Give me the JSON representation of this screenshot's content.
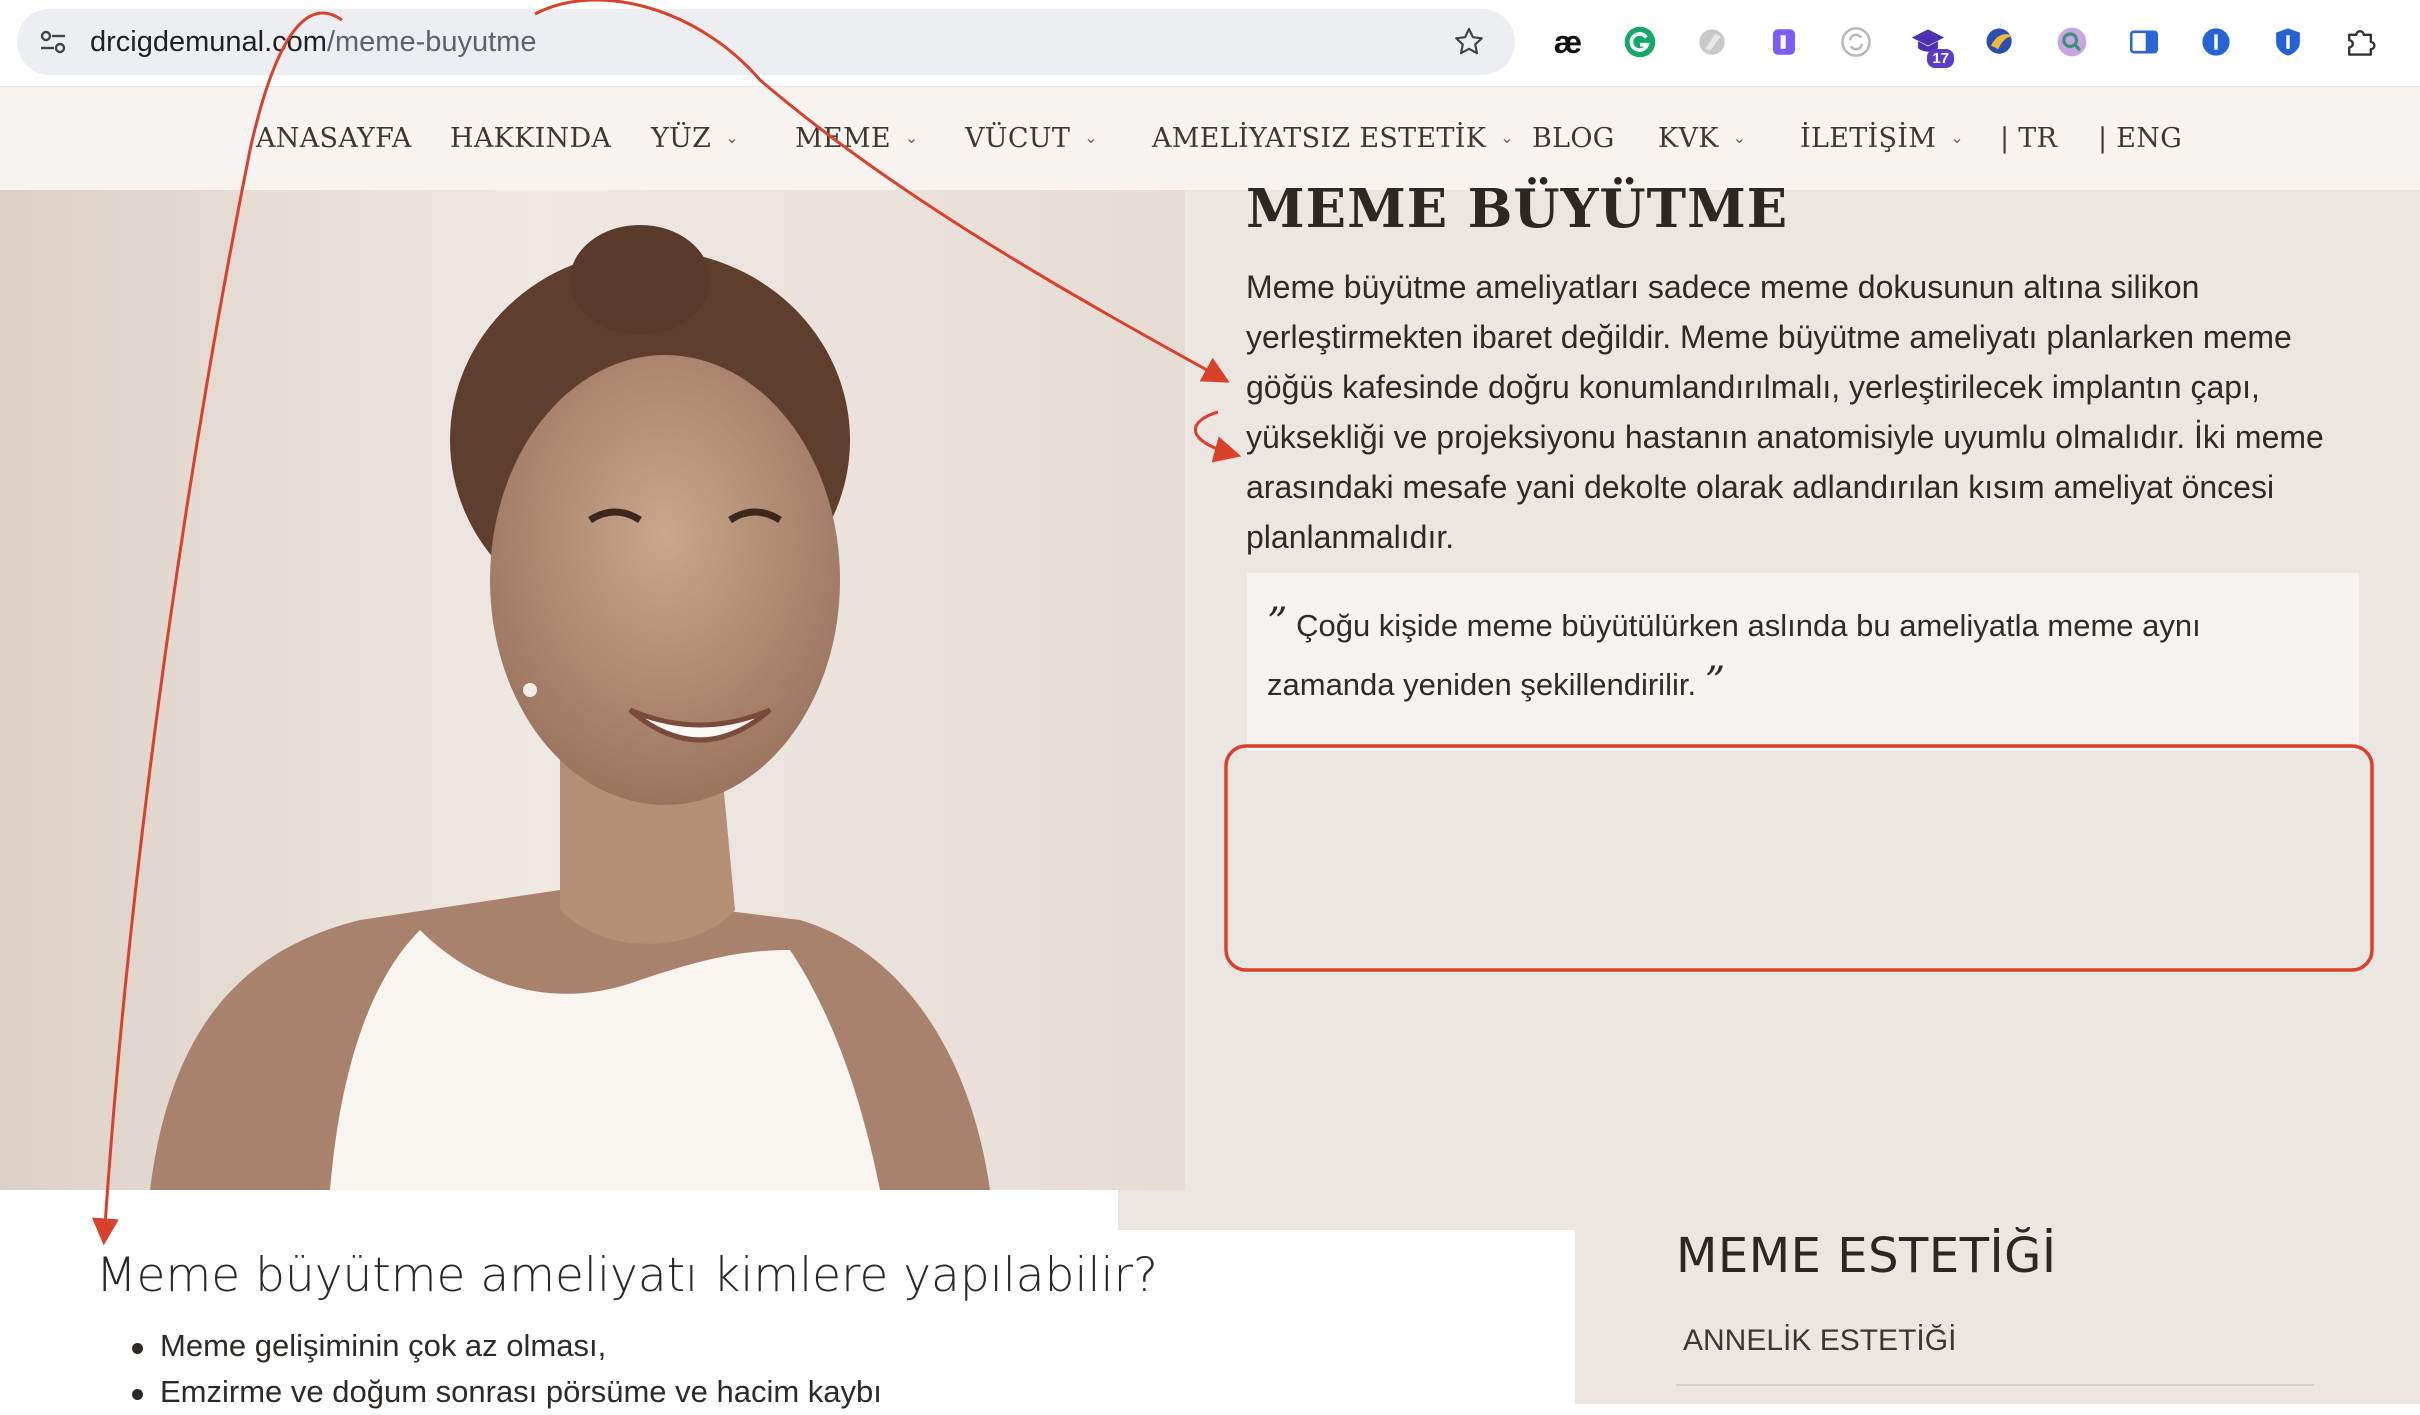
{
  "browser": {
    "url_domain": "drcigdemunal.com",
    "url_path": "/meme-buyutme",
    "extensions": {
      "ae_label": "æ",
      "badge_count": "17"
    }
  },
  "nav": {
    "items": [
      {
        "label": "ANASAYFA",
        "has_dropdown": false
      },
      {
        "label": "HAKKINDA",
        "has_dropdown": false
      },
      {
        "label": "YÜZ",
        "has_dropdown": true
      },
      {
        "label": "MEME",
        "has_dropdown": true
      },
      {
        "label": "VÜCUT",
        "has_dropdown": true
      },
      {
        "label": "AMELİYATSIZ ESTETİK",
        "has_dropdown": true
      },
      {
        "label": "BLOG",
        "has_dropdown": false
      },
      {
        "label": "KVK",
        "has_dropdown": true
      },
      {
        "label": "İLETİŞİM",
        "has_dropdown": true
      },
      {
        "label": "| TR",
        "has_dropdown": false
      },
      {
        "label": "| ENG",
        "has_dropdown": false
      }
    ]
  },
  "hero": {
    "title": "MEME BÜYÜTME",
    "body": "Meme büyütme ameliyatları sadece meme dokusunun altına silikon yerleştirmekten ibaret değildir. Meme büyütme ameliyatı planlarken meme göğüs kafesinde doğru konumlandırılmalı, yerleştirilecek implantın çapı, yüksekliği ve projeksiyonu hastanın anatomisiyle uyumlu olmalıdır. İki meme arasındaki mesafe yani dekolte olarak adlandırılan kısım ameliyat öncesi planlanmalıdır.",
    "quote": "Çoğu kişide meme büyütülürken aslında bu ameliyatla meme aynı zamanda yeniden şekillendirilir."
  },
  "main": {
    "section_title": "Meme büyütme ameliyatı kimlere yapılabilir?",
    "bullets": [
      "Meme gelişiminin çok az olması,",
      "Emzirme ve doğum sonrası pörsüme ve hacim kaybı"
    ]
  },
  "sidebar": {
    "title": "MEME ESTETİĞİ",
    "links": [
      "ANNELİK ESTETİĞİ"
    ]
  },
  "colors": {
    "annotation": "#d9412b",
    "nav_bg": "#f6f3f1",
    "hero_bg": "#ebe6e1"
  }
}
